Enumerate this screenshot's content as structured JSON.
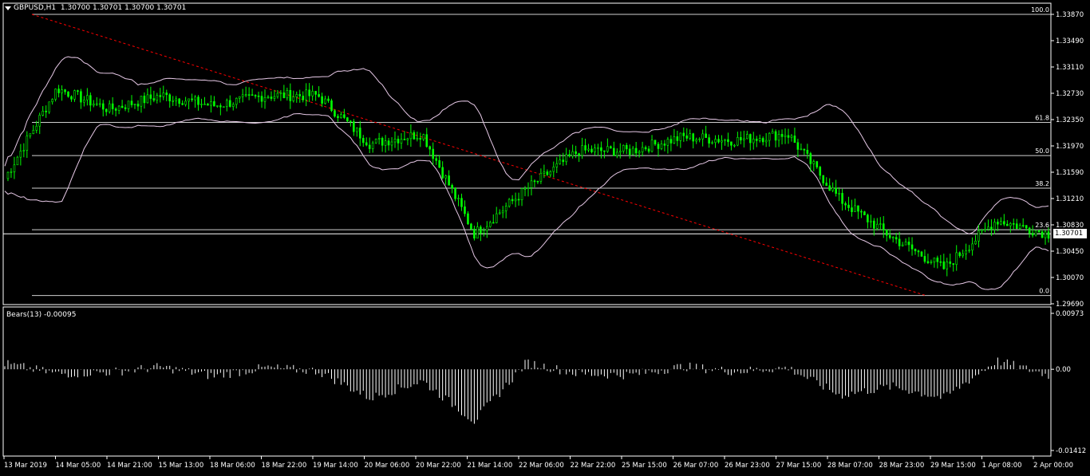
{
  "window": {
    "symbol_header": "GBPUSD,H1",
    "ohlc": "1.30700 1.30701 1.30700 1.30701",
    "current_price": "1.30701"
  },
  "main_chart": {
    "price_ticks": [
      "1.33870",
      "1.33490",
      "1.33110",
      "1.32730",
      "1.32350",
      "1.31970",
      "1.31590",
      "1.31210",
      "1.30830",
      "1.30450",
      "1.30070",
      "1.29690"
    ],
    "fib_levels": [
      {
        "label": "100.0",
        "price": 1.3387
      },
      {
        "label": "61.8",
        "price": 1.3231
      },
      {
        "label": "50.0",
        "price": 1.3183
      },
      {
        "label": "38.2",
        "price": 1.3136
      },
      {
        "label": "23.6",
        "price": 1.3076
      },
      {
        "label": "0.0",
        "price": 1.2981
      }
    ],
    "candle_color": "#00ff00",
    "band_color": "#e6c8e6",
    "trendline_color": "#ff0000"
  },
  "indicator": {
    "label": "Bears(13) -0.00095",
    "ticks": [
      "0.00973",
      "0.00",
      "-0.01412"
    ]
  },
  "time_axis": [
    "13 Mar 2019",
    "14 Mar 05:00",
    "14 Mar 21:00",
    "15 Mar 13:00",
    "18 Mar 06:00",
    "18 Mar 22:00",
    "19 Mar 14:00",
    "20 Mar 06:00",
    "20 Mar 22:00",
    "21 Mar 14:00",
    "22 Mar 06:00",
    "22 Mar 22:00",
    "25 Mar 15:00",
    "26 Mar 07:00",
    "26 Mar 23:00",
    "27 Mar 15:00",
    "28 Mar 07:00",
    "28 Mar 23:00",
    "29 Mar 15:00",
    "1 Apr 08:00",
    "2 Apr 00:00"
  ],
  "chart_data": {
    "type": "line",
    "title": "GBPUSD,H1",
    "x": [
      "13 Mar 2019",
      "14 Mar 05:00",
      "14 Mar 21:00",
      "15 Mar 13:00",
      "18 Mar 06:00",
      "18 Mar 22:00",
      "19 Mar 14:00",
      "20 Mar 06:00",
      "20 Mar 22:00",
      "21 Mar 14:00",
      "22 Mar 06:00",
      "22 Mar 22:00",
      "25 Mar 15:00",
      "26 Mar 07:00",
      "26 Mar 23:00",
      "27 Mar 15:00",
      "28 Mar 07:00",
      "28 Mar 23:00",
      "29 Mar 15:00",
      "1 Apr 08:00",
      "2 Apr 00:00"
    ],
    "series": [
      {
        "name": "GBPUSD,H1",
        "values": [
          1.315,
          1.328,
          1.325,
          1.327,
          1.3255,
          1.327,
          1.327,
          1.32,
          1.3215,
          1.307,
          1.3135,
          1.319,
          1.319,
          1.321,
          1.3205,
          1.3215,
          1.312,
          1.3065,
          1.302,
          1.309,
          1.307
        ]
      },
      {
        "name": "Bears(13)",
        "values": [
          0.001,
          -0.0008,
          -0.0005,
          0.0004,
          -0.0012,
          0.0003,
          -0.0003,
          -0.005,
          -0.002,
          -0.009,
          0.0012,
          -0.0008,
          -0.001,
          0.0005,
          -0.0004,
          0.0003,
          -0.0045,
          -0.003,
          -0.005,
          0.0015,
          -0.001
        ]
      }
    ],
    "ylim": [
      1.2969,
      1.3387
    ],
    "indicator_ylim": [
      -0.01412,
      0.00973
    ],
    "grid": false
  }
}
